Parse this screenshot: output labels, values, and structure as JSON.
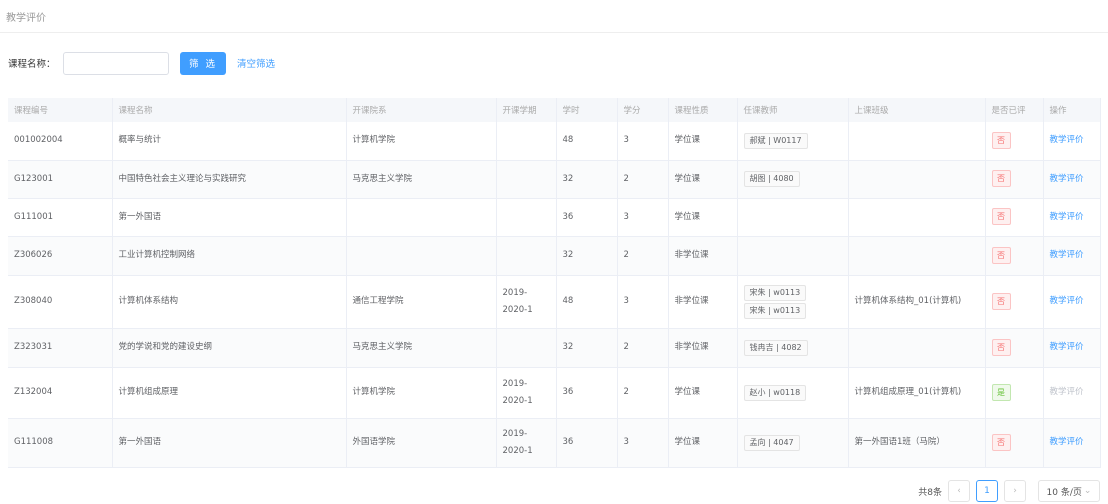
{
  "page_title": "教学评价",
  "filter": {
    "label": "课程名称：",
    "value": "",
    "button": "筛 选",
    "clear": "清空筛选"
  },
  "columns": [
    "课程编号",
    "课程名称",
    "开课院系",
    "开课学期",
    "学时",
    "学分",
    "课程性质",
    "任课教师",
    "上课班级",
    "是否已评",
    "操作"
  ],
  "rows": [
    {
      "code": "001002004",
      "name": "概率与统计",
      "dept": "计算机学院",
      "term": "",
      "hours": "48",
      "credit": "3",
      "type": "学位课",
      "teachers": [
        "郝斌 | W0117"
      ],
      "cls": "",
      "rated": "否",
      "op": "教学评价"
    },
    {
      "code": "G123001",
      "name": "中国特色社会主义理论与实践研究",
      "dept": "马克思主义学院",
      "term": "",
      "hours": "32",
      "credit": "2",
      "type": "学位课",
      "teachers": [
        "胡图 | 4080"
      ],
      "cls": "",
      "rated": "否",
      "op": "教学评价"
    },
    {
      "code": "G111001",
      "name": "第一外国语",
      "dept": "",
      "term": "",
      "hours": "36",
      "credit": "3",
      "type": "学位课",
      "teachers": [],
      "cls": "",
      "rated": "否",
      "op": "教学评价"
    },
    {
      "code": "Z306026",
      "name": "工业计算机控制网络",
      "dept": "",
      "term": "",
      "hours": "32",
      "credit": "2",
      "type": "非学位课",
      "teachers": [],
      "cls": "",
      "rated": "否",
      "op": "教学评价"
    },
    {
      "code": "Z308040",
      "name": "计算机体系结构",
      "dept": "通信工程学院",
      "term": "2019-2020-1",
      "hours": "48",
      "credit": "3",
      "type": "非学位课",
      "teachers": [
        "宋朱 | w0113",
        "宋朱 | w0113"
      ],
      "cls": "计算机体系结构_01(计算机)",
      "rated": "否",
      "op": "教学评价"
    },
    {
      "code": "Z323031",
      "name": "党的学说和党的建设史纲",
      "dept": "马克思主义学院",
      "term": "",
      "hours": "32",
      "credit": "2",
      "type": "非学位课",
      "teachers": [
        "钱冉吉 | 4082"
      ],
      "cls": "",
      "rated": "否",
      "op": "教学评价"
    },
    {
      "code": "Z132004",
      "name": "计算机组成原理",
      "dept": "计算机学院",
      "term": "2019-2020-1",
      "hours": "36",
      "credit": "2",
      "type": "学位课",
      "teachers": [
        "赵小 | w0118"
      ],
      "cls": "计算机组成原理_01(计算机)",
      "rated": "是",
      "op": "教学评价"
    },
    {
      "code": "G111008",
      "name": "第一外国语",
      "dept": "外国语学院",
      "term": "2019-2020-1",
      "hours": "36",
      "credit": "3",
      "type": "学位课",
      "teachers": [
        "孟向 | 4047"
      ],
      "cls": "第一外国语1班（马院）",
      "rated": "否",
      "op": "教学评价"
    }
  ],
  "pagination": {
    "total": "共8条",
    "prev": "‹",
    "page": "1",
    "next": "›",
    "page_size": "10 条/页"
  }
}
